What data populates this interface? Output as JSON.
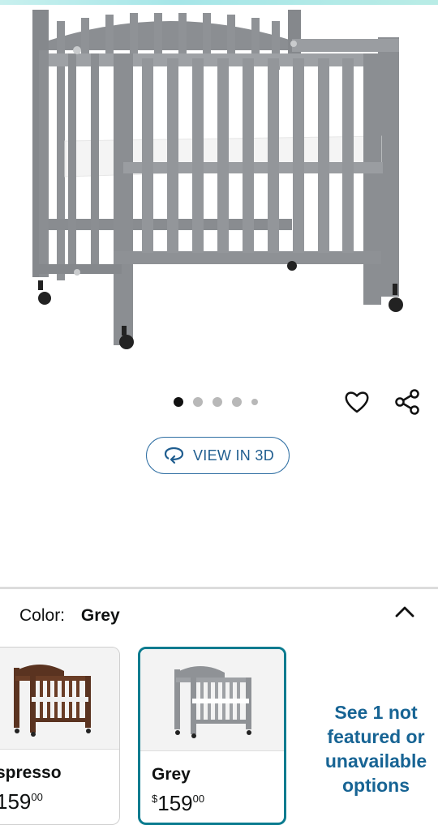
{
  "gallery": {
    "product_image": "crib-grey-image",
    "image_count": 5,
    "active_index": 0
  },
  "actions": {
    "wishlist_icon": "heart-icon",
    "share_icon": "share-icon",
    "view3d_label": "VIEW IN 3D",
    "view3d_icon": "rotate-3d-icon"
  },
  "color_selector": {
    "label": "Color:",
    "selected": "Grey",
    "collapse_icon": "chevron-up-icon",
    "options": [
      {
        "name": "Espresso",
        "visible_name": "spresso",
        "price_symbol": "$",
        "price_whole": "159",
        "price_visible_whole": "159",
        "price_cents": "00",
        "color": "#5a3320"
      },
      {
        "name": "Grey",
        "visible_name": "Grey",
        "price_symbol": "$",
        "price_whole": "159",
        "price_visible_whole": "159",
        "price_cents": "00",
        "color": "#8f9296"
      }
    ],
    "see_more": "See 1 not featured or unavailable options"
  },
  "colors": {
    "accent_border": "#0a7b8f",
    "link": "#176494",
    "button_border": "#2f6fa3"
  }
}
